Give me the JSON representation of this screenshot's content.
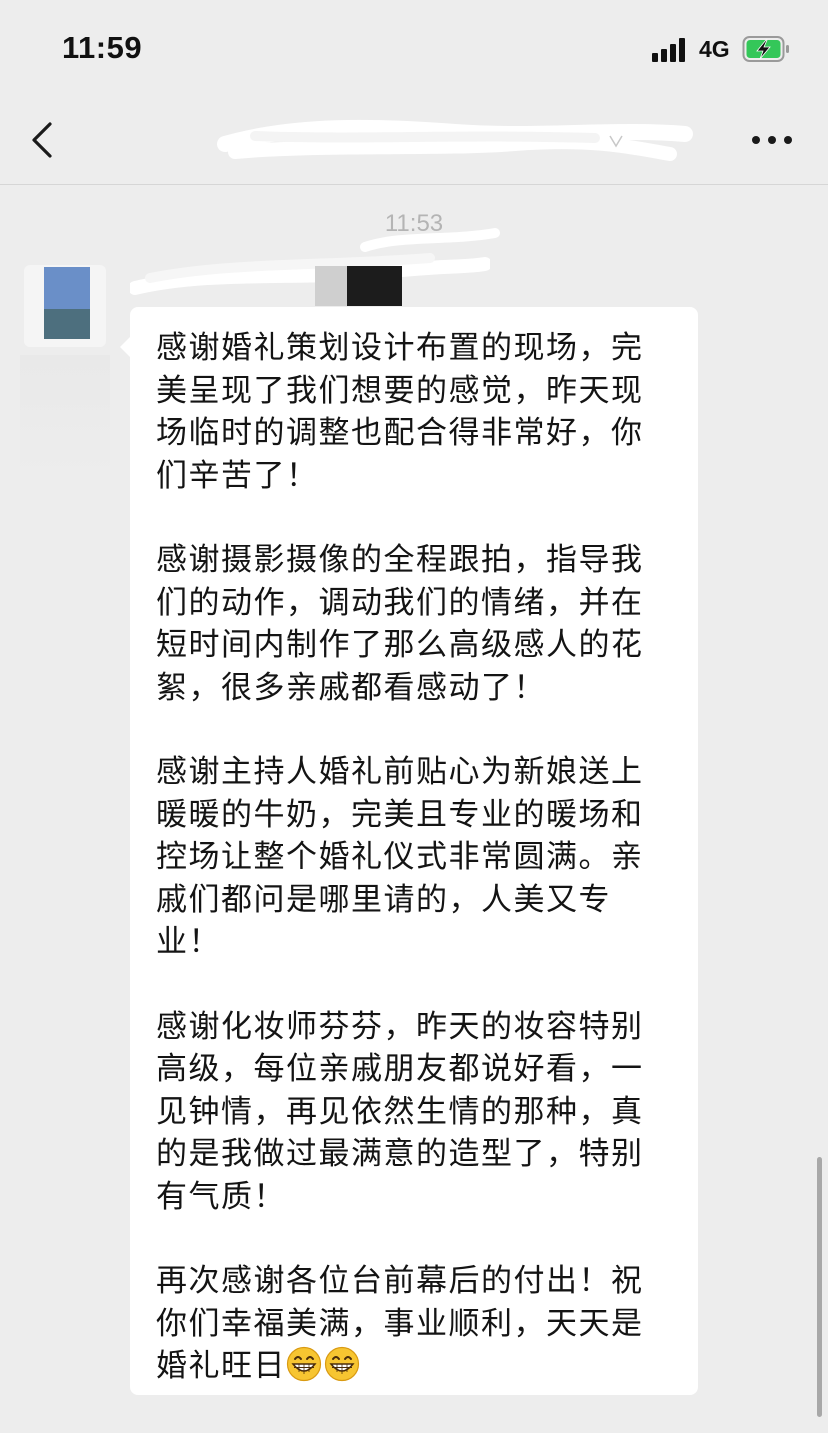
{
  "status_bar": {
    "time": "11:59",
    "network": "4G",
    "signal_icon": "signal-bars-icon",
    "battery_icon": "battery-charging-icon",
    "battery_color": "#34c759"
  },
  "nav_bar": {
    "back_icon": "chevron-left-icon",
    "more_icon": "more-dots-icon"
  },
  "chat": {
    "timestamp": "11:53",
    "message": {
      "paragraphs": [
        "感谢婚礼策划设计布置的现场，完美呈现了我们想要的感觉，昨天现场临时的调整也配合得非常好，你们辛苦了！",
        "感谢摄影摄像的全程跟拍，指导我们的动作，调动我们的情绪，并在短时间内制作了那么高级感人的花絮，很多亲戚都看感动了！",
        "感谢主持人婚礼前贴心为新娘送上暖暖的牛奶，完美且专业的暖场和控场让整个婚礼仪式非常圆满。亲戚们都问是哪里请的，人美又专业！",
        "感谢化妆师芬芬，昨天的妆容特别高级，每位亲戚朋友都说好看，一见钟情，再见依然生情的那种，真的是我做过最满意的造型了，特别有气质！",
        "再次感谢各位台前幕后的付出！祝你们幸福美满，事业顺利，天天是婚礼旺日"
      ],
      "trailing_emoji": [
        "grin-emoji",
        "grin-emoji"
      ]
    }
  },
  "colors": {
    "background": "#ededed",
    "bubble": "#ffffff",
    "text": "#141414",
    "timestamp": "#b4b4b4"
  }
}
